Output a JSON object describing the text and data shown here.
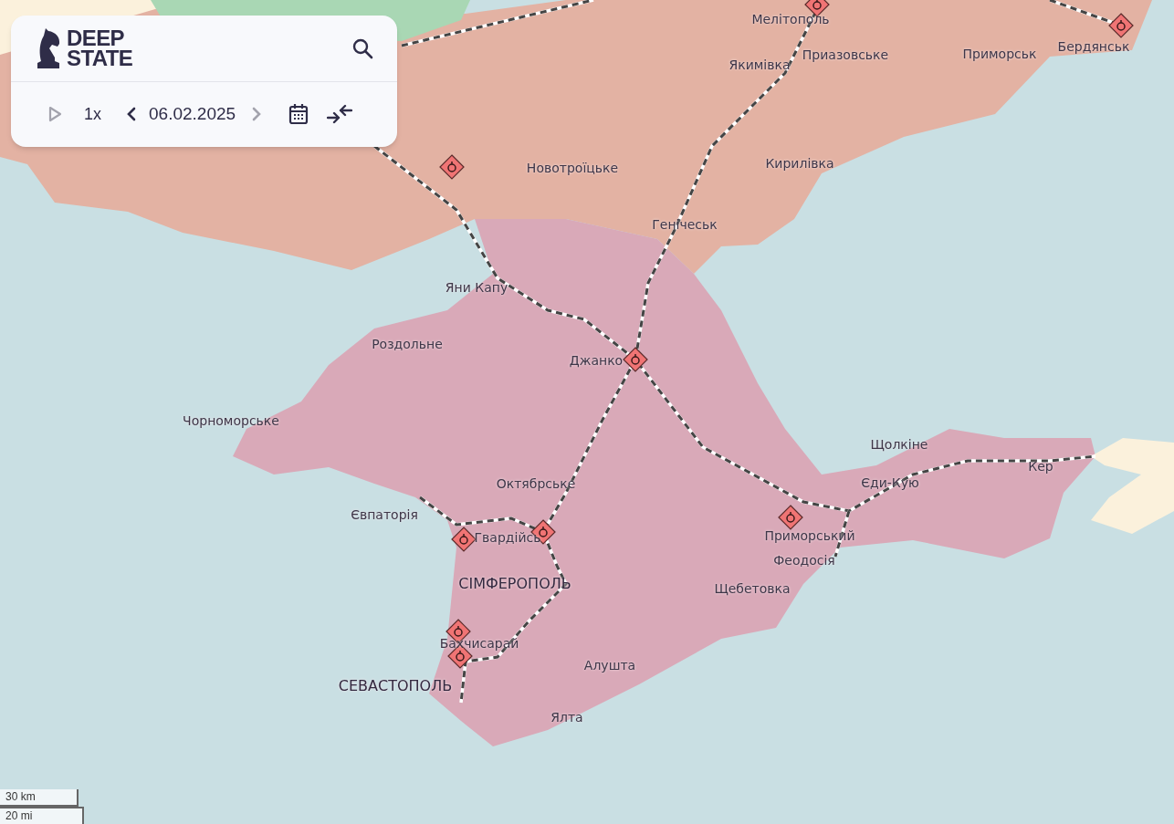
{
  "panel": {
    "logo": [
      "DEEP",
      "STATE"
    ],
    "player": {
      "play_disabled": true,
      "speed": "1x"
    },
    "date": {
      "value": "06.02.2025",
      "prev_disabled": false,
      "next_disabled": true
    }
  },
  "map": {
    "labels": [
      {
        "text": "Мелітополь",
        "kind": "town"
      },
      {
        "text": "Якимівка",
        "kind": "town"
      },
      {
        "text": "Приазовське",
        "kind": "town"
      },
      {
        "text": "Приморськ",
        "kind": "town"
      },
      {
        "text": "Бердянськ",
        "kind": "town"
      },
      {
        "text": "Новотроїцьке",
        "kind": "town"
      },
      {
        "text": "Кирилівка",
        "kind": "town"
      },
      {
        "text": "Генічеськ",
        "kind": "town"
      },
      {
        "text": "Яни Капу",
        "kind": "town"
      },
      {
        "text": "Роздольне",
        "kind": "town"
      },
      {
        "text": "Джанко",
        "kind": "town"
      },
      {
        "text": "Чорноморське",
        "kind": "town"
      },
      {
        "text": "Щолкіне",
        "kind": "town"
      },
      {
        "text": "Кер",
        "kind": "town"
      },
      {
        "text": "Єди-Кую",
        "kind": "town"
      },
      {
        "text": "Октябрське",
        "kind": "town"
      },
      {
        "text": "Євпаторія",
        "kind": "town"
      },
      {
        "text": "Гвардійсь",
        "kind": "town"
      },
      {
        "text": "Приморський",
        "kind": "town"
      },
      {
        "text": "Феодосія",
        "kind": "town"
      },
      {
        "text": "СІМФЕРОПОЛЬ",
        "kind": "city"
      },
      {
        "text": "Щебетовка",
        "kind": "town"
      },
      {
        "text": "Бахчисарай",
        "kind": "town"
      },
      {
        "text": "Алушта",
        "kind": "town"
      },
      {
        "text": "СЕВАСТОПОЛЬ",
        "kind": "city"
      },
      {
        "text": "Ялта",
        "kind": "town"
      }
    ],
    "scale": [
      "30 km",
      "20 mi"
    ]
  }
}
